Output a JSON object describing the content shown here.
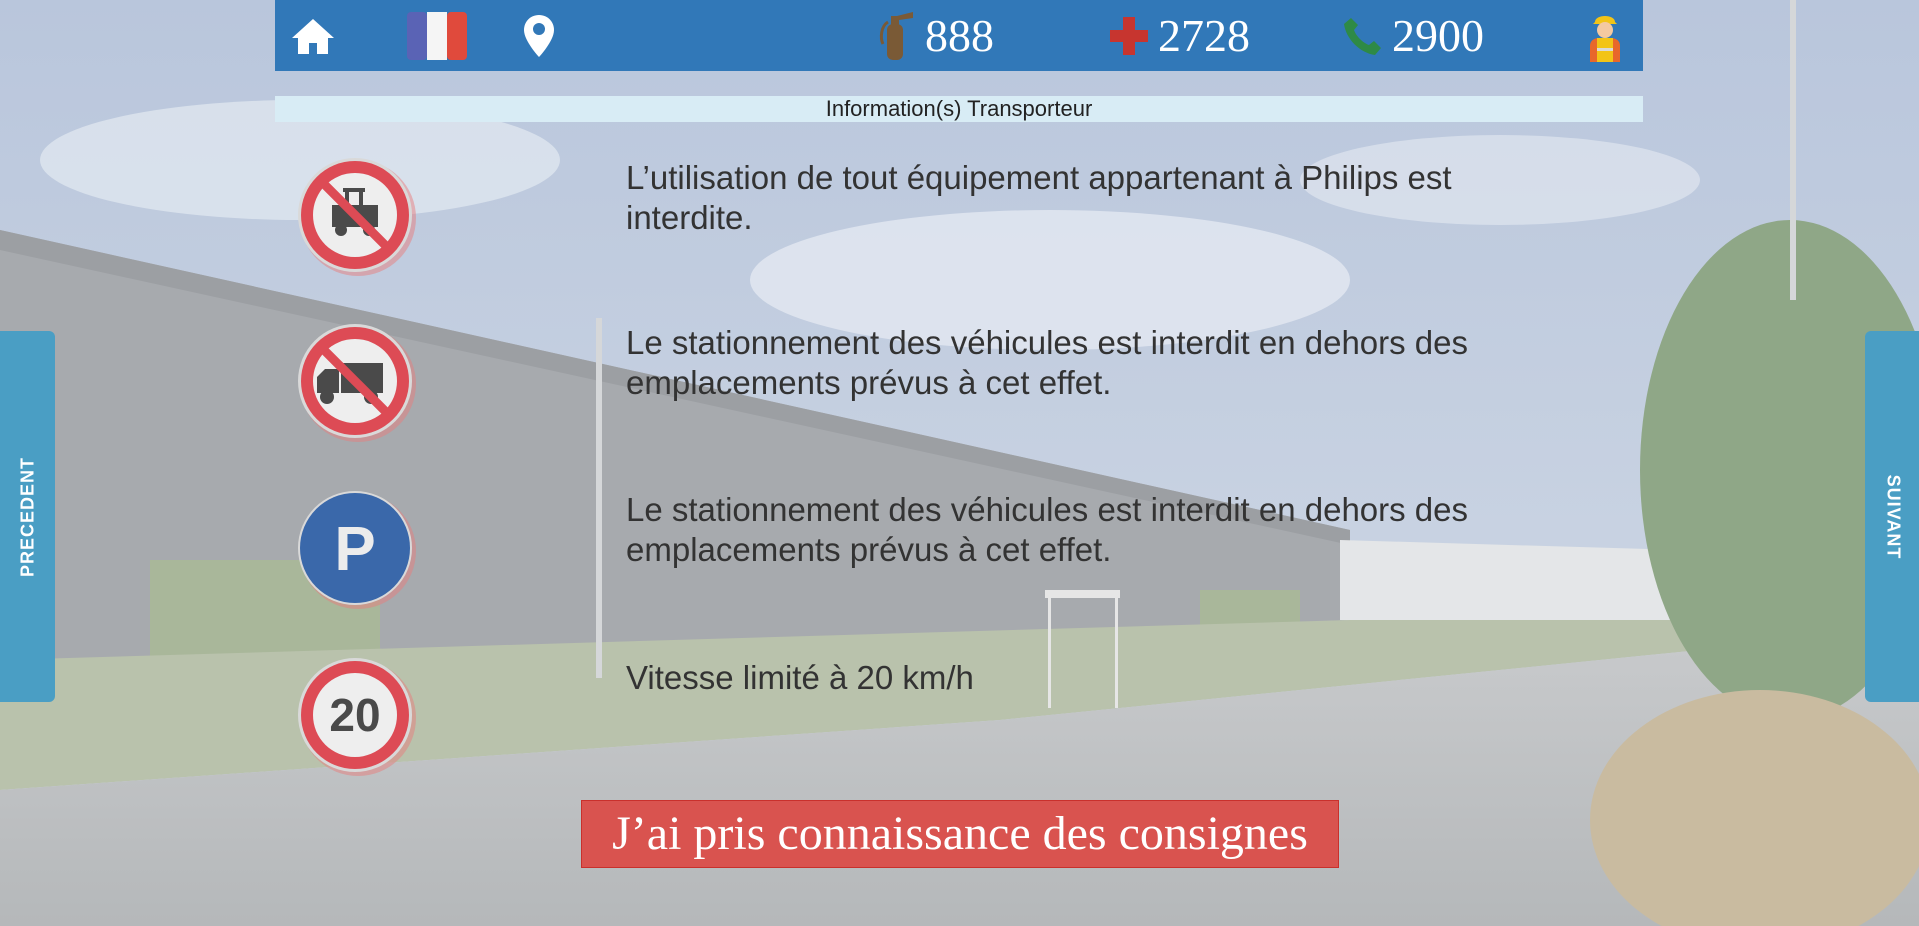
{
  "header": {
    "extinguisher_number": "888",
    "first_aid_number": "2728",
    "phone_number": "2900"
  },
  "info_bar": {
    "title": "Information(s) Transporteur"
  },
  "rules": [
    {
      "text": "L’utilisation de tout équipement appartenant à Philips est interdite.",
      "icon": "no-forklift-icon"
    },
    {
      "text": "Le stationnement des véhicules est interdit en dehors des emplacements prévus à cet effet.",
      "icon": "no-truck-icon"
    },
    {
      "text": "Le stationnement des véhicules est interdit en dehors des emplacements prévus à cet effet.",
      "icon": "parking-icon"
    },
    {
      "text": "Vitesse limité à 20 km/h",
      "icon": "speed-limit-icon",
      "speed_value": "20"
    }
  ],
  "nav": {
    "previous_label": "PRECEDENT",
    "next_label": "SUIVANT"
  },
  "confirm_button": {
    "label": "J’ai pris connaissance des consignes"
  },
  "colors": {
    "header_bg": "#3178b8",
    "info_bar_bg": "#d8ecf5",
    "side_tab_bg": "#4a9ec4",
    "confirm_bg": "#d9534f"
  }
}
